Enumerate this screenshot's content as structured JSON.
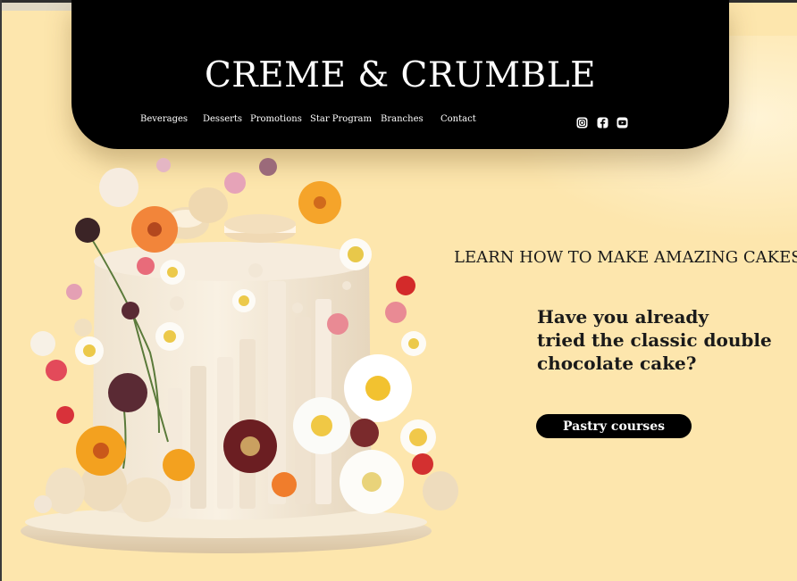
{
  "header": {
    "brand": "CREME & CRUMBLE",
    "nav": [
      {
        "label": "Beverages"
      },
      {
        "label": "Desserts"
      },
      {
        "label": "Promotions"
      },
      {
        "label": "Star Program"
      },
      {
        "label": "Branches"
      },
      {
        "label": "Contact"
      }
    ],
    "social": [
      "instagram-icon",
      "facebook-icon",
      "youtube-icon"
    ]
  },
  "hero": {
    "headline": "LEARN HOW TO MAKE AMAZING CAKES",
    "question_lines": [
      "Have you already",
      "tried the classic double",
      "chocolate cake?"
    ],
    "cta_label": "Pastry courses"
  },
  "colors": {
    "background": "#fde6ad",
    "header": "#000000",
    "cta": "#000000",
    "text": "#1a1a1a"
  }
}
